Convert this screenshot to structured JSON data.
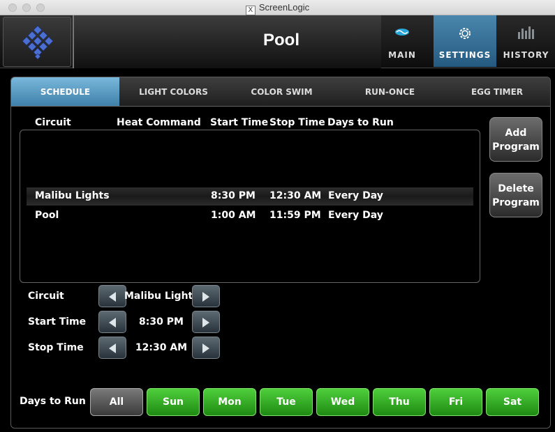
{
  "window": {
    "title": "ScreenLogic"
  },
  "header": {
    "title": "Pool",
    "nav": [
      {
        "id": "main",
        "label": "MAIN",
        "icon": "pool-icon",
        "active": false
      },
      {
        "id": "settings",
        "label": "SETTINGS",
        "icon": "gear-icon",
        "active": true
      },
      {
        "id": "history",
        "label": "HISTORY",
        "icon": "bar-chart-icon",
        "active": false
      }
    ]
  },
  "tabs": [
    {
      "label": "SCHEDULE",
      "active": true
    },
    {
      "label": "LIGHT COLORS",
      "active": false
    },
    {
      "label": "COLOR SWIM",
      "active": false
    },
    {
      "label": "RUN-ONCE",
      "active": false
    },
    {
      "label": "EGG TIMER",
      "active": false
    }
  ],
  "schedule": {
    "columns": [
      "Circuit",
      "Heat Command",
      "Start Time",
      "Stop Time",
      "Days to Run"
    ],
    "rows": [
      {
        "circuit": "Malibu Lights",
        "heat": "",
        "start": "8:30  PM",
        "stop": "12:30  AM",
        "days": "Every Day",
        "selected": true
      },
      {
        "circuit": "Pool",
        "heat": "",
        "start": "1:00  AM",
        "stop": "11:59  PM",
        "days": "Every Day",
        "selected": false
      }
    ]
  },
  "buttons": {
    "add_line1": "Add",
    "add_line2": "Program",
    "delete_line1": "Delete",
    "delete_line2": "Program"
  },
  "editor": {
    "circuit_label": "Circuit",
    "circuit_value": "Malibu Lights",
    "start_label": "Start Time",
    "start_value": "8:30  PM",
    "stop_label": "Stop Time",
    "stop_value": "12:30  AM"
  },
  "days": {
    "label": "Days to Run",
    "all": "All",
    "items": [
      "Sun",
      "Mon",
      "Tue",
      "Wed",
      "Thu",
      "Fri",
      "Sat"
    ]
  },
  "colors": {
    "accent": "#3d7fa8",
    "day_on": "#2ea81f"
  }
}
